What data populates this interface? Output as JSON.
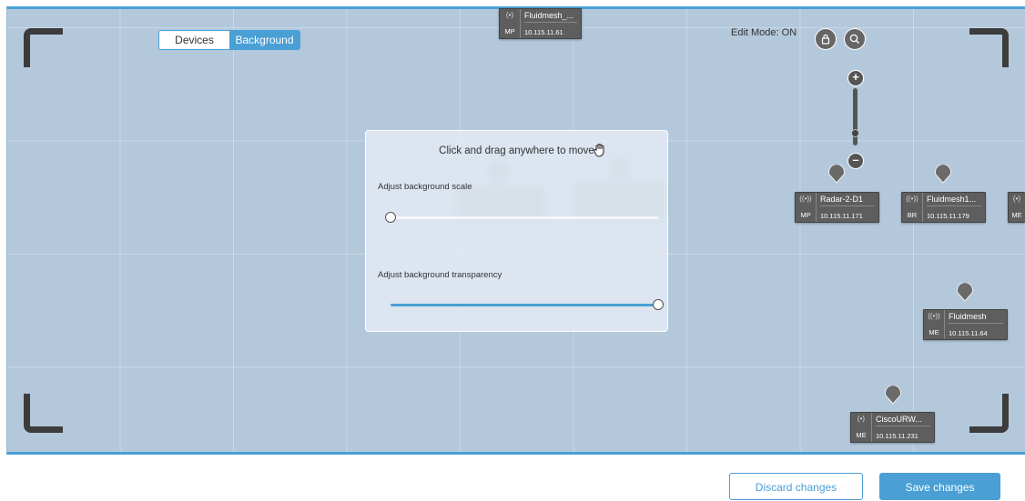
{
  "view_toggle": {
    "devices": "Devices",
    "background": "Background",
    "active": "Background"
  },
  "edit_mode": {
    "label": "Edit Mode: ON"
  },
  "icons": {
    "lock": "lock-icon",
    "search": "search-icon",
    "zoom_in": "plus-icon",
    "zoom_out": "minus-icon",
    "hand": "hand-icon"
  },
  "zoom": {
    "plus": "+",
    "minus": "–"
  },
  "panel": {
    "title": "Click and drag anywhere to move",
    "scale_label": "Adjust background scale",
    "scale_value": 0,
    "transparency_label": "Adjust background transparency",
    "transparency_value": 1
  },
  "devices": [
    {
      "id": "top",
      "icon": "(•)",
      "type": "MP",
      "name": "Fluidmesh_...",
      "ip": "10.115.11.61"
    },
    {
      "id": "radar",
      "icon": "((•))",
      "type": "MP",
      "name": "Radar-2-D1",
      "ip": "10.115.11.171"
    },
    {
      "id": "fluid1",
      "icon": "((•))",
      "type": "BR",
      "name": "Fluidmesh1...",
      "ip": "10.115.11.179"
    },
    {
      "id": "edge",
      "icon": "(•)",
      "type": "ME",
      "name": "",
      "ip": ""
    },
    {
      "id": "fluid",
      "icon": "((•))",
      "type": "ME",
      "name": "Fluidmesh",
      "ip": "10.115.11.64"
    },
    {
      "id": "cisco",
      "icon": "(•)",
      "type": "ME",
      "name": "CiscoURW...",
      "ip": "10.115.11.231"
    }
  ],
  "buttons": {
    "discard": "Discard changes",
    "save": "Save changes"
  },
  "colors": {
    "accent": "#4a9fd5",
    "canvas": "#b4c8dc",
    "device": "#5e5e5e"
  }
}
